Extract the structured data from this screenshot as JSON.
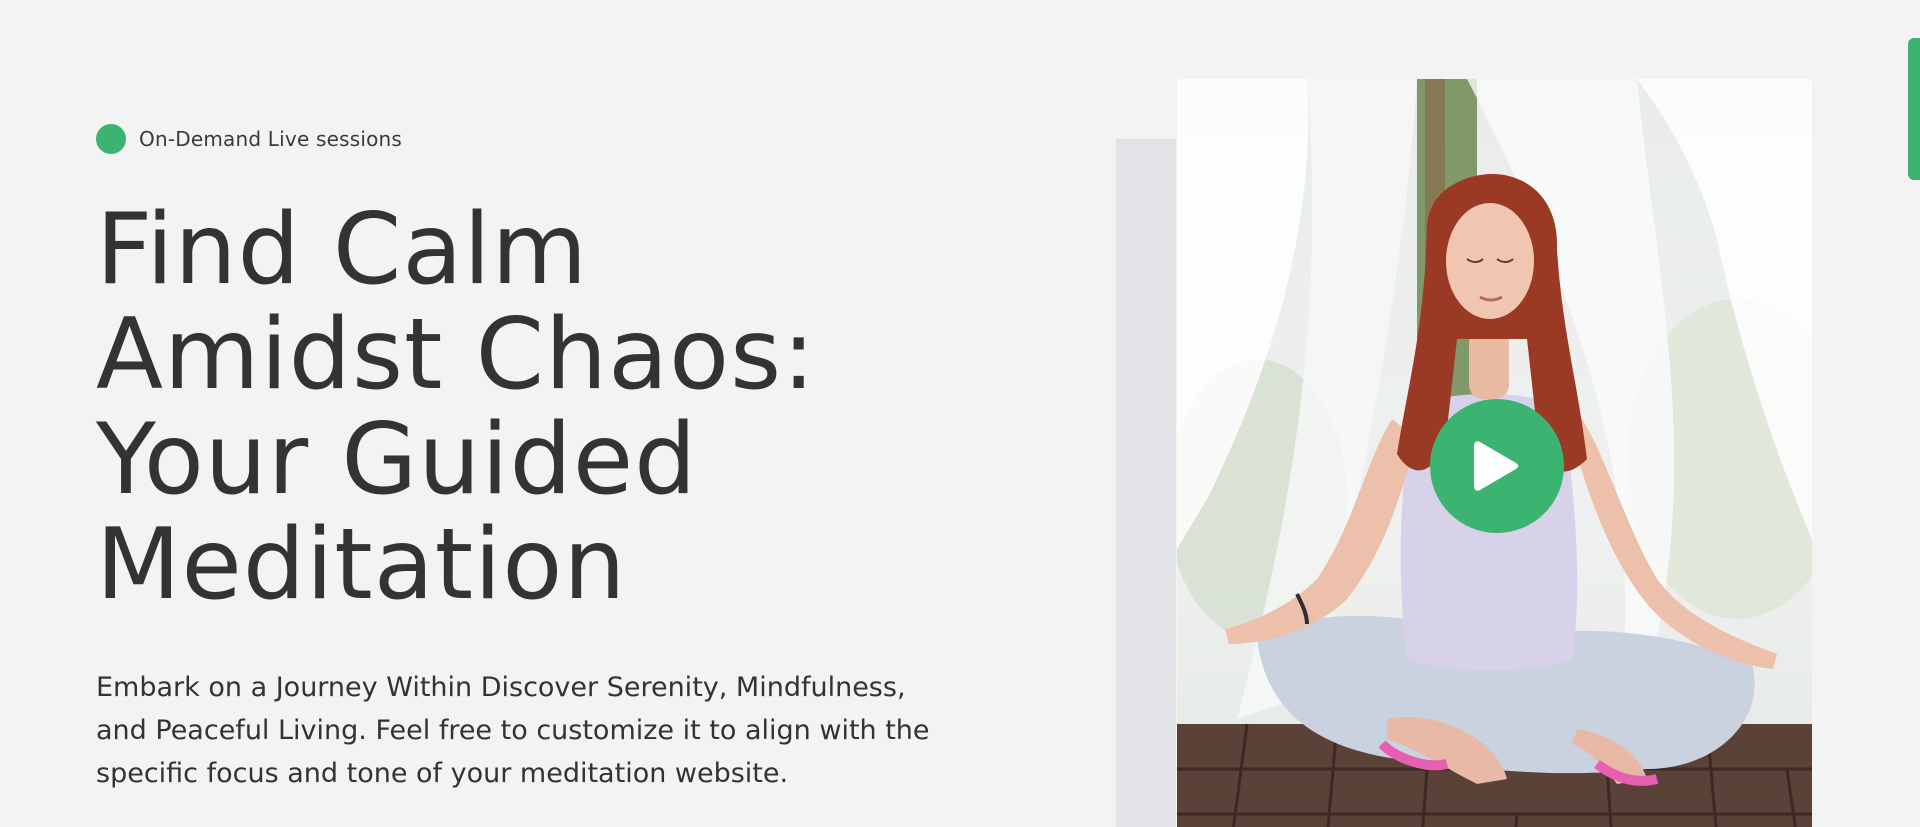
{
  "badge": {
    "text": "On-Demand Live sessions",
    "dot_color": "#3cb371"
  },
  "hero": {
    "title_lines": [
      "Find Calm",
      "Amidst Chaos:",
      "Your Guided",
      "Meditation"
    ],
    "description_lines": [
      "Embark on a Journey Within Discover Serenity, Mindfulness,",
      "and Peaceful Living. Feel free to customize it to align with the",
      "specific focus and tone of your meditation website."
    ]
  },
  "media": {
    "image_subject": "woman meditating in lotus pose on a wooden deck between white curtains",
    "play_icon": "play-icon",
    "accent_color": "#3cb371"
  },
  "colors": {
    "background": "#f3f3f3",
    "text": "#333333",
    "accent": "#3cb371",
    "panel": "#e2e3e6"
  }
}
